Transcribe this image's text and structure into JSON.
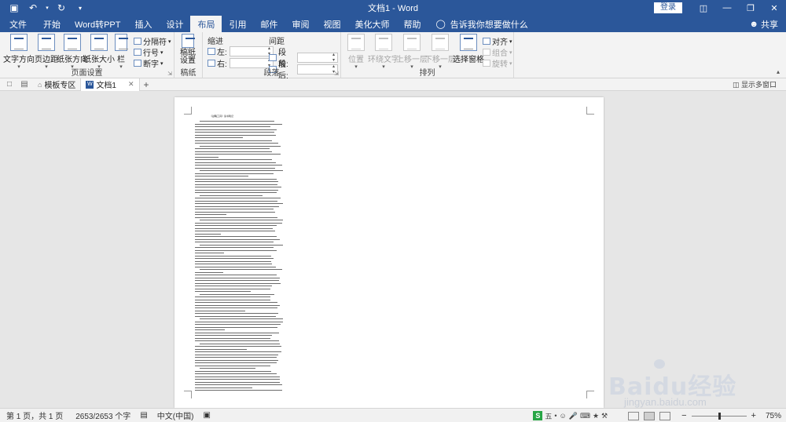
{
  "title_bar": {
    "doc_title": "文档1 - Word",
    "login_label": "登录"
  },
  "tabs": [
    "文件",
    "开始",
    "Word转PPT",
    "插入",
    "设计",
    "布局",
    "引用",
    "邮件",
    "审阅",
    "视图",
    "美化大师",
    "帮助"
  ],
  "tell_me": "告诉我你想要做什么",
  "share_label": "共享",
  "ribbon": {
    "page_setup": {
      "label": "页面设置",
      "text_direction": "文字方向",
      "margins": "页边距",
      "orientation": "纸张方向",
      "size": "纸张大小",
      "columns": "栏",
      "breaks": "分隔符",
      "line_numbers": "行号",
      "hyphenation": "断字"
    },
    "draft": {
      "label": "稿纸",
      "settings_line1": "稿纸",
      "settings_line2": "设置"
    },
    "paragraph": {
      "label": "段落",
      "indent": "缩进",
      "spacing": "间距",
      "left": "左:",
      "right": "右:",
      "before": "段前:",
      "after": "段后:"
    },
    "arrange": {
      "label": "排列",
      "position": "位置",
      "wrap_text": "环绕文字",
      "bring_forward": "上移一层",
      "send_backward": "下移一层",
      "selection_pane": "选择窗格",
      "align": "对齐",
      "group": "组合",
      "rotate": "旋转"
    }
  },
  "doc_tabs": {
    "template": "模板专区",
    "document": "文档1",
    "multi_window": "显示多窗口"
  },
  "page": {
    "heading": "《战略工具》读书笔记"
  },
  "status_bar": {
    "page_info": "第 1 页，共 1 页",
    "word_count": "2653/2653 个字",
    "language": "中文(中国)",
    "zoom": "75%",
    "ime_mode": "五"
  },
  "watermark": {
    "brand": "Baidu经验",
    "url": "jingyan.baidu.com"
  },
  "colors": {
    "accent": "#2b579a",
    "ribbon_bg": "#f3f3f3"
  }
}
